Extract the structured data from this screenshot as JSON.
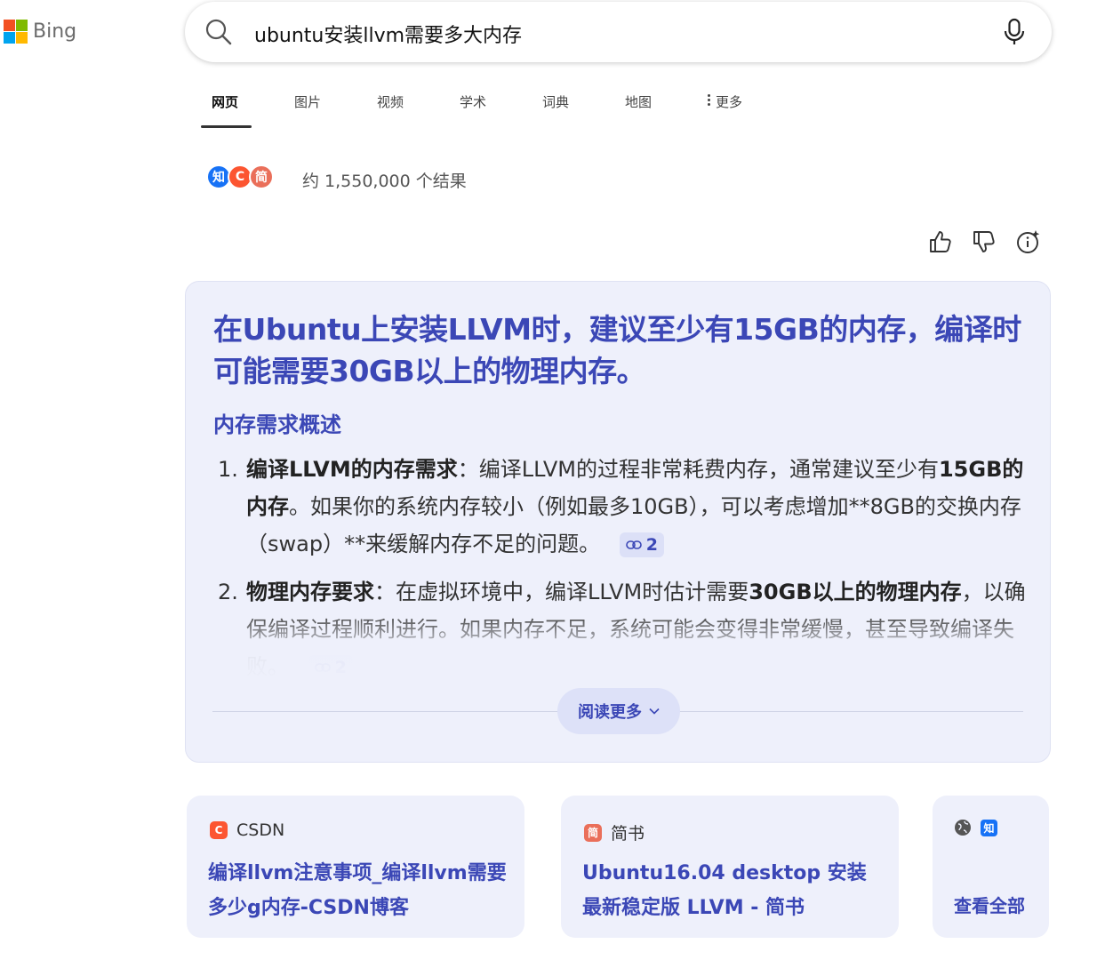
{
  "brand": {
    "name": "Bing",
    "colors": [
      "#f25022",
      "#7fba00",
      "#00a4ef",
      "#ffb900"
    ]
  },
  "search": {
    "query": "ubuntu安装llvm需要多大内存"
  },
  "tabs": [
    {
      "label": "网页",
      "active": true
    },
    {
      "label": "图片"
    },
    {
      "label": "视频"
    },
    {
      "label": "学术"
    },
    {
      "label": "词典"
    },
    {
      "label": "地图"
    },
    {
      "label": "更多"
    }
  ],
  "results": {
    "source_badges": [
      {
        "text": "知",
        "color": "#1772f6"
      },
      {
        "text": "C",
        "color": "#fc5531"
      },
      {
        "text": "简",
        "color": "#ea6f5a"
      }
    ],
    "count_text": "约 1,550,000 个结果"
  },
  "answer": {
    "headline": "在Ubuntu上安装LLVM时，建议至少有15GB的内存，编译时可能需要30GB以上的物理内存。",
    "subhead": "内存需求概述",
    "items": [
      {
        "num": "1.",
        "bold": "编译LLVM的内存需求",
        "text1": "：编译LLVM的过程非常耗费内存，通常建议至少有",
        "bold2": "15GB的内存",
        "text2": "。如果你的系统内存较小（例如最多10GB），可以考虑增加**8GB的交换内存（swap）**来缓解内存不足的问题。",
        "cite": "2"
      },
      {
        "num": "2.",
        "bold": "物理内存要求",
        "text1": "：在虚拟环境中，编译LLVM时估计需要",
        "bold2": "30GB以上的物理内存",
        "text2": "，以确保编译过程顺利进行。如果内存不足，系统可能会变得非常缓慢，甚至导致编译失败。",
        "cite": "2"
      }
    ],
    "read_more": "阅读更多"
  },
  "source_cards": [
    {
      "site": "CSDN",
      "logo": "C",
      "logo_color": "#fc5531",
      "title": "编译llvm注意事项_编译llvm需要多少g内存-CSDN博客"
    },
    {
      "site": "简书",
      "logo": "简",
      "logo_color": "#ea6f5a",
      "title": "Ubuntu16.04 desktop 安装最新稳定版 LLVM - 简书"
    }
  ],
  "view_all": {
    "label": "查看全部",
    "badge": "知",
    "badge_color": "#1772f6"
  },
  "accent_color": "#3b47b6"
}
